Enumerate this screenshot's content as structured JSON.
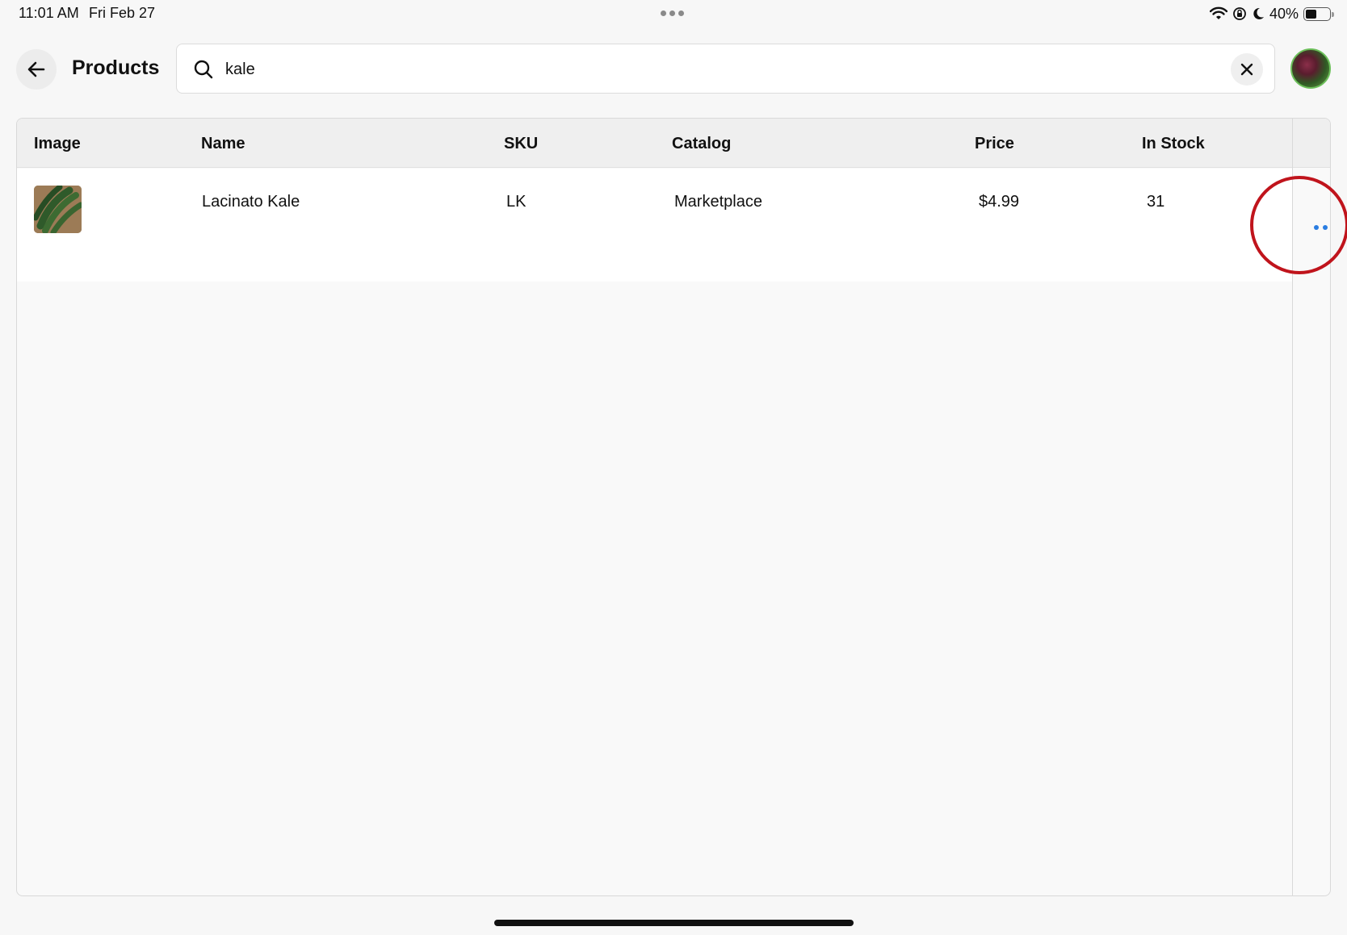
{
  "status_bar": {
    "time": "11:01 AM",
    "date": "Fri Feb 27",
    "battery_percent": "40%",
    "battery_level": 0.4
  },
  "header": {
    "title": "Products",
    "back_icon": "arrow-left-icon"
  },
  "search": {
    "value": "kale",
    "placeholder": "",
    "icon": "search-icon",
    "clear_icon": "close-icon"
  },
  "table": {
    "columns": [
      "Image",
      "Name",
      "SKU",
      "Catalog",
      "Price",
      "In Stock"
    ],
    "rows": [
      {
        "image": "kale-thumbnail",
        "name": "Lacinato Kale",
        "sku": "LK",
        "catalog": "Marketplace",
        "price": "$4.99",
        "in_stock": "31",
        "actions_icon": "more-horizontal-icon"
      }
    ]
  },
  "colors": {
    "accent": "#2a7de1",
    "highlight": "#c0141c"
  }
}
